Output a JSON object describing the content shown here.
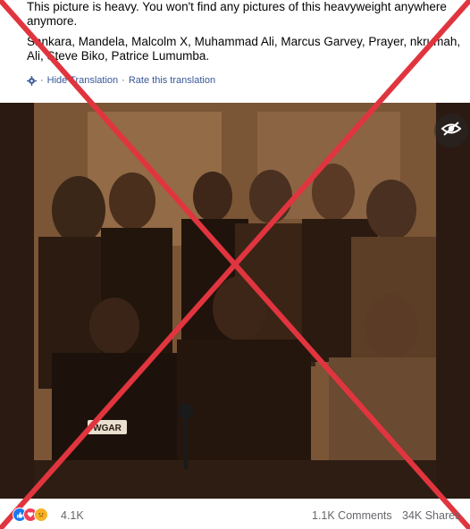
{
  "post": {
    "line1": "This picture is heavy. You won't find any pictures of this heavyweight anywhere anymore.",
    "line2": "Sankara, Mandela, Malcolm X, Muhammad Ali, Marcus Garvey, Prayer, nkrumah, Ali, Steve Biko, Patrice Lumumba."
  },
  "translation": {
    "hide": "Hide Translation",
    "separator": "·",
    "rate": "Rate this translation"
  },
  "photo": {
    "mic_label": "WGAR",
    "eye_icon": "eye-icon"
  },
  "reactions": {
    "icons": [
      "like-icon",
      "love-icon",
      "sad-icon"
    ],
    "count": "4.1K",
    "comments": "1.1K Comments",
    "shares": "34K Shares"
  },
  "colors": {
    "link": "#385898",
    "muted": "#65676b",
    "cross": "#e0353f",
    "like": "#1877f2",
    "love": "#f33e58",
    "sad": "#f7b125"
  }
}
